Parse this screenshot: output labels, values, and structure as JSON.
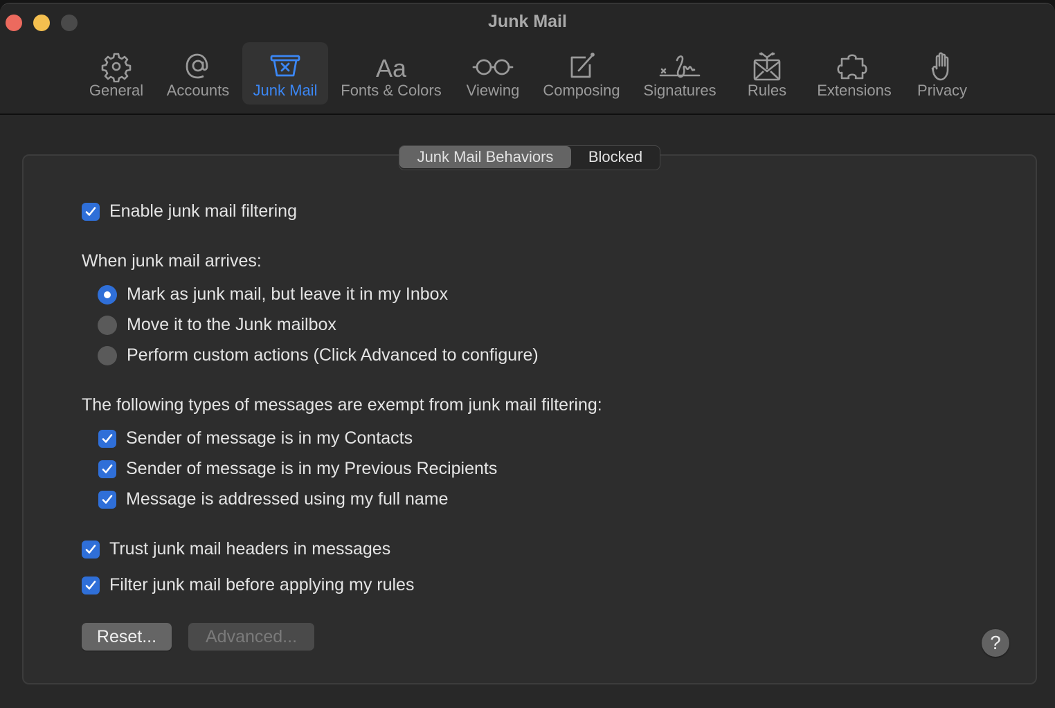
{
  "window": {
    "title": "Junk Mail",
    "accent_color": "#3b87f5"
  },
  "toolbar": {
    "tabs": [
      {
        "label": "General",
        "icon": "gear-icon",
        "active": false
      },
      {
        "label": "Accounts",
        "icon": "at-sign-icon",
        "active": false
      },
      {
        "label": "Junk Mail",
        "icon": "junk-bin-icon",
        "active": true
      },
      {
        "label": "Fonts & Colors",
        "icon": "font-aa-icon",
        "active": false
      },
      {
        "label": "Viewing",
        "icon": "glasses-icon",
        "active": false
      },
      {
        "label": "Composing",
        "icon": "compose-icon",
        "active": false
      },
      {
        "label": "Signatures",
        "icon": "signature-icon",
        "active": false
      },
      {
        "label": "Rules",
        "icon": "rules-envelope-icon",
        "active": false
      },
      {
        "label": "Extensions",
        "icon": "puzzle-icon",
        "active": false
      },
      {
        "label": "Privacy",
        "icon": "hand-icon",
        "active": false
      }
    ]
  },
  "segmented": {
    "options": [
      "Junk Mail Behaviors",
      "Blocked"
    ],
    "selected": "Junk Mail Behaviors"
  },
  "settings": {
    "enable_filtering": {
      "label": "Enable junk mail filtering",
      "checked": true
    },
    "arrival_heading": "When junk mail arrives:",
    "arrival_options": [
      {
        "label": "Mark as junk mail, but leave it in my Inbox",
        "selected": true
      },
      {
        "label": "Move it to the Junk mailbox",
        "selected": false
      },
      {
        "label": "Perform custom actions (Click Advanced to configure)",
        "selected": false
      }
    ],
    "exempt_heading": "The following types of messages are exempt from junk mail filtering:",
    "exempt_options": [
      {
        "label": "Sender of message is in my Contacts",
        "checked": true
      },
      {
        "label": "Sender of message is in my Previous Recipients",
        "checked": true
      },
      {
        "label": "Message is addressed using my full name",
        "checked": true
      }
    ],
    "trust_headers": {
      "label": "Trust junk mail headers in messages",
      "checked": true
    },
    "filter_before_rules": {
      "label": "Filter junk mail before applying my rules",
      "checked": true
    }
  },
  "buttons": {
    "reset": "Reset...",
    "advanced": "Advanced...",
    "advanced_enabled": false,
    "help": "?"
  }
}
